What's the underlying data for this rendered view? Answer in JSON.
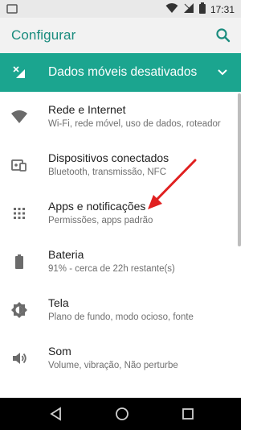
{
  "status_bar": {
    "time": "17:31"
  },
  "app_bar": {
    "title": "Configurar",
    "search_icon": "search-icon"
  },
  "banner": {
    "text": "Dados móveis desativados",
    "icon": "mobile-data-off-icon"
  },
  "settings": [
    {
      "title": "Rede e Internet",
      "subtitle": "Wi-Fi, rede móvel, uso de dados, roteador",
      "icon": "wifi-icon"
    },
    {
      "title": "Dispositivos conectados",
      "subtitle": "Bluetooth, transmissão, NFC",
      "icon": "connected-devices-icon"
    },
    {
      "title": "Apps e notificações",
      "subtitle": "Permissões, apps padrão",
      "icon": "apps-grid-icon"
    },
    {
      "title": "Bateria",
      "subtitle": "91% - cerca de 22h restante(s)",
      "icon": "battery-icon"
    },
    {
      "title": "Tela",
      "subtitle": "Plano de fundo, modo ocioso, fonte",
      "icon": "brightness-icon"
    },
    {
      "title": "Som",
      "subtitle": "Volume, vibração, Não perturbe",
      "icon": "volume-icon"
    }
  ],
  "annotation": {
    "arrow_color": "#e02020"
  },
  "colors": {
    "accent": "#1a8c7e",
    "banner_bg": "#1ba58f"
  }
}
